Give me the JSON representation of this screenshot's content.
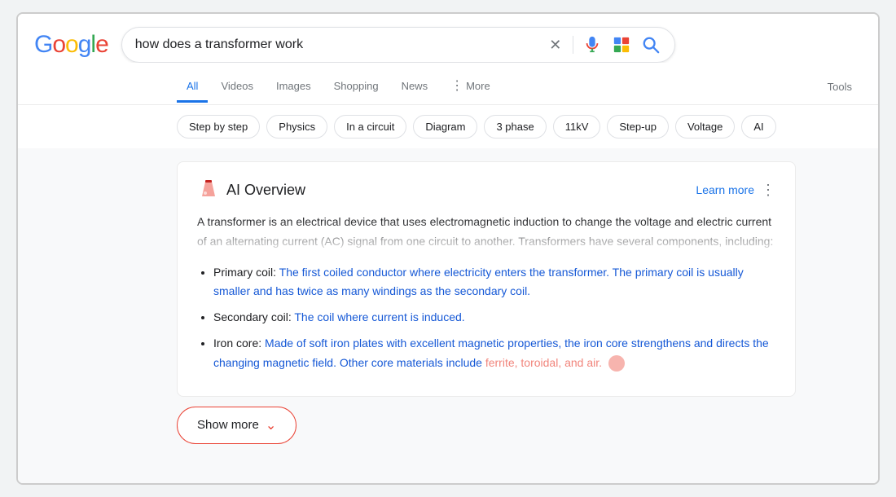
{
  "logo": {
    "letters": [
      {
        "char": "G",
        "color": "#4285F4"
      },
      {
        "char": "o",
        "color": "#EA4335"
      },
      {
        "char": "o",
        "color": "#FBBC05"
      },
      {
        "char": "g",
        "color": "#4285F4"
      },
      {
        "char": "l",
        "color": "#34A853"
      },
      {
        "char": "e",
        "color": "#EA4335"
      }
    ]
  },
  "search": {
    "query": "how does a transformer work",
    "placeholder": "Search"
  },
  "nav": {
    "tabs": [
      {
        "label": "All",
        "active": true
      },
      {
        "label": "Videos",
        "active": false
      },
      {
        "label": "Images",
        "active": false
      },
      {
        "label": "Shopping",
        "active": false
      },
      {
        "label": "News",
        "active": false
      },
      {
        "label": "More",
        "active": false
      }
    ],
    "tools_label": "Tools"
  },
  "chips": [
    "Step by step",
    "Physics",
    "In a circuit",
    "Diagram",
    "3 phase",
    "11kV",
    "Step-up",
    "Voltage",
    "AI"
  ],
  "ai_overview": {
    "title": "AI Overview",
    "learn_more": "Learn more",
    "intro": "A transformer is an electrical device that uses electromagnetic induction to change the voltage and electric current of an alternating current (AC) signal from one circuit to another. Transformers have several components, including:",
    "bullets": [
      {
        "term": "Primary coil:",
        "desc": " The first coiled conductor where electricity enters the transformer. The primary coil is usually smaller and has twice as many windings as the secondary coil."
      },
      {
        "term": "Secondary coil:",
        "desc": " The coil where current is induced."
      },
      {
        "term": "Iron core:",
        "desc": " Made of soft iron plates with excellent magnetic properties, the iron core strengthens and directs the changing magnetic field. Other core materials include ferrite, toroidal, and air."
      }
    ],
    "show_more_label": "Show more"
  }
}
